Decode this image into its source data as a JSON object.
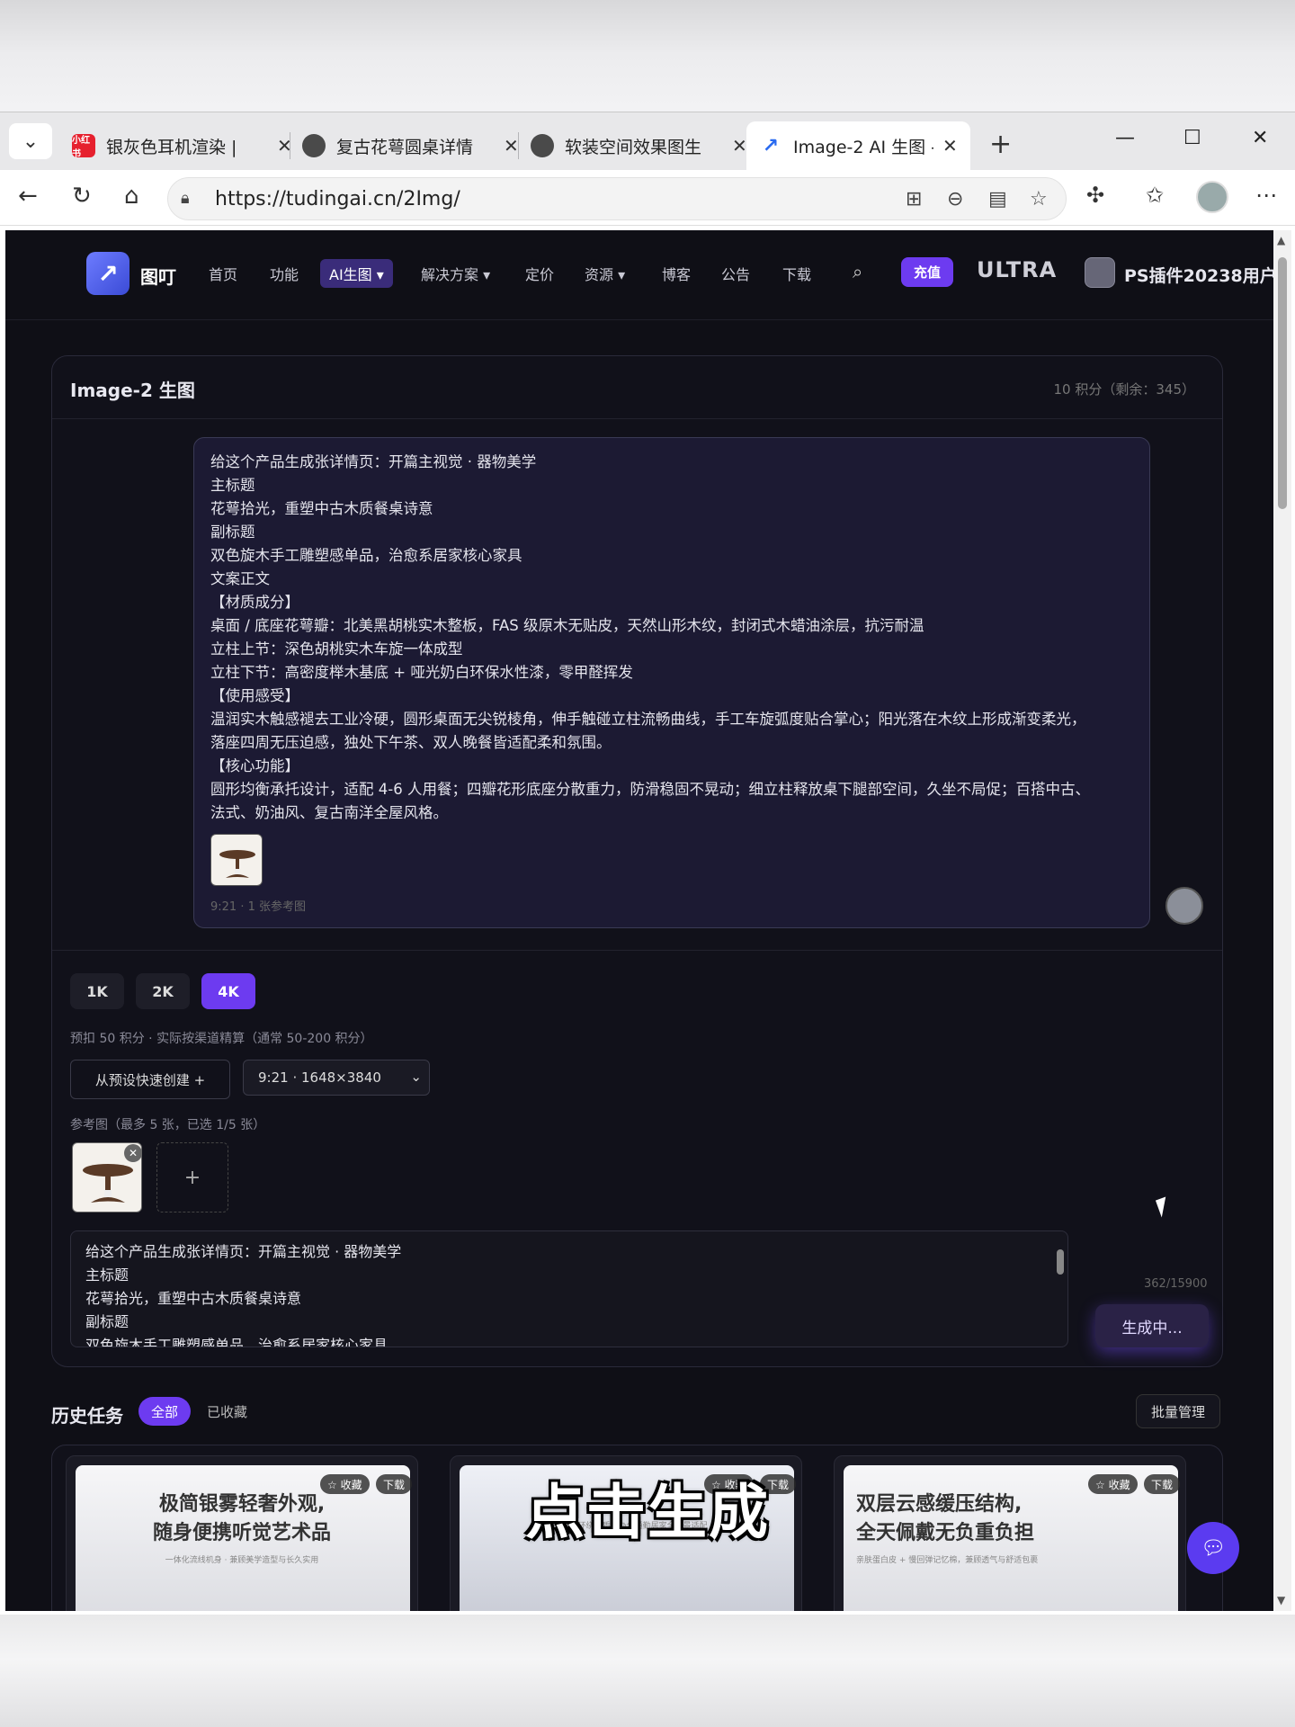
{
  "browser": {
    "tabs": [
      {
        "title": "银灰色耳机渲染 |",
        "favicon": "red-brand-icon"
      },
      {
        "title": "复古花萼圆桌详情",
        "favicon": "avatar-icon"
      },
      {
        "title": "软装空间效果图生",
        "favicon": "avatar-icon"
      },
      {
        "title": "Image-2 AI 生图 -",
        "favicon": "tudingai-icon"
      }
    ],
    "url": "https://tudingai.cn/2Img/"
  },
  "site": {
    "brand": "图叮",
    "nav": [
      "首页",
      "功能",
      "AI生图 ▾",
      "解决方案 ▾",
      "定价",
      "资源 ▾",
      "博客",
      "公告",
      "下载"
    ],
    "recharge": "充值",
    "ultra": "ULTRA",
    "username": "PS插件20238用户"
  },
  "card": {
    "title": "Image-2 生图",
    "points": "10 积分（剩余：345）",
    "message_lines": [
      "给这个产品生成张详情页：开篇主视觉 · 器物美学",
      "主标题",
      "花萼拾光，重塑中古木质餐桌诗意",
      "副标题",
      "双色旋木手工雕塑感单品，治愈系居家核心家具",
      "文案正文",
      "【材质成分】",
      "桌面 / 底座花萼瓣：北美黑胡桃实木整板，FAS 级原木无贴皮，天然山形木纹，封闭式木蜡油涂层，抗污耐温",
      "立柱上节：深色胡桃实木车旋一体成型",
      "立柱下节：高密度榉木基底 + 哑光奶白环保水性漆，零甲醛挥发",
      "【使用感受】",
      "温润实木触感褪去工业冷硬，圆形桌面无尖锐棱角，伸手触碰立柱流畅曲线，手工车旋弧度贴合掌心；阳光落在木纹上形成渐变柔光，",
      "落座四周无压迫感，独处下午茶、双人晚餐皆适配柔和氛围。",
      "【核心功能】",
      "圆形均衡承托设计，适配 4-6 人用餐；四瓣花形底座分散重力，防滑稳固不晃动；细立柱释放桌下腿部空间，久坐不局促；百搭中古、",
      "法式、奶油风、复古南洋全屋风格。"
    ],
    "message_meta": "9:21 · 1 张参考图",
    "resolutions": [
      "1K",
      "2K",
      "4K"
    ],
    "active_resolution": "4K",
    "hint": "预扣 50 积分 · 实际按渠道精算（通常 50-200 积分）",
    "preset_button": "从预设快速创建  +",
    "ratio": "9:21 · 1648×3840",
    "ref_label": "参考图（最多 5 张，已选 1/5 张）",
    "prompt_lines": [
      "给这个产品生成张详情页：开篇主视觉 · 器物美学",
      "主标题",
      "花萼拾光，重塑中古木质餐桌诗意",
      "副标题",
      "双色旋木手工雕塑感单品，治愈系居家核心家具"
    ],
    "counter": "362/15900",
    "generate_button": "生成中..."
  },
  "history": {
    "title": "历史任务",
    "tabs": [
      "全部",
      "已收藏"
    ],
    "batch": "批量管理",
    "cards": [
      {
        "headline": "极简银雾轻奢外观,",
        "headline2": "随身便携听觉艺术品",
        "small": "一体化流线机身 · 兼顾美学造型与长久实用",
        "fav": "☆ 收藏",
        "dl": "下载"
      },
      {
        "headline": "",
        "headline2": "",
        "small": "HiFi 立体环绕音质，办公通勤居家全场景适配",
        "fav": "☆ 收藏",
        "dl": "下载"
      },
      {
        "headline": "双层云感缓压结构,",
        "headline2": "全天佩戴无负重负担",
        "small": "亲肤蛋白皮 + 慢回弹记忆棉，兼顾透气与舒适包裹",
        "fav": "☆ 收藏",
        "dl": "下载"
      }
    ]
  },
  "overlay_caption": "点击生成"
}
